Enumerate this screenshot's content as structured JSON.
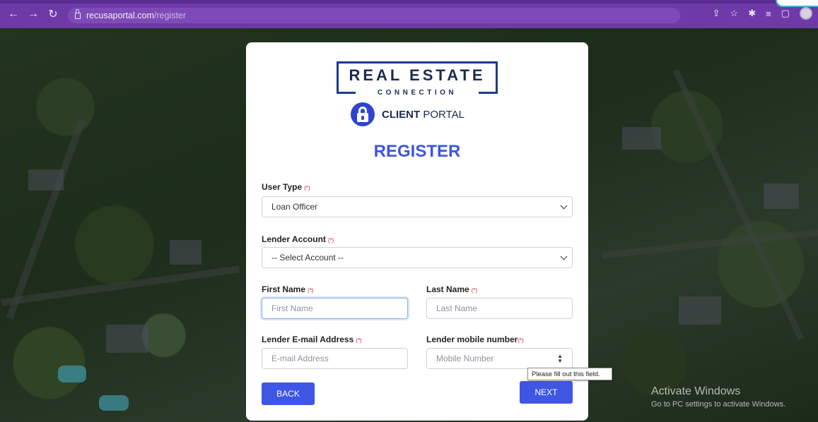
{
  "browser": {
    "url_domain": "recusaportal.com",
    "url_path": "/register"
  },
  "logo": {
    "title": "REAL ESTATE",
    "subtitle": "CONNECTION",
    "portal_bold": "CLIENT",
    "portal_rest": " PORTAL"
  },
  "form": {
    "heading": "REGISTER",
    "required_mark": "(*)",
    "user_type": {
      "label": "User Type",
      "value": "Loan Officer"
    },
    "lender_account": {
      "label": "Lender Account",
      "value": "-- Select Account --"
    },
    "first_name": {
      "label": "First Name",
      "placeholder": "First Name"
    },
    "last_name": {
      "label": "Last Name",
      "placeholder": "Last Name"
    },
    "email": {
      "label": "Lender E-mail Address",
      "placeholder": "E-mail Address"
    },
    "mobile": {
      "label": "Lender mobile number",
      "placeholder": "Mobile Number"
    },
    "back_label": "BACK",
    "next_label": "NEXT",
    "validation_tooltip": "Please fill out this field."
  },
  "watermark": {
    "line1": "Activate Windows",
    "line2": "Go to PC settings to activate Windows."
  }
}
